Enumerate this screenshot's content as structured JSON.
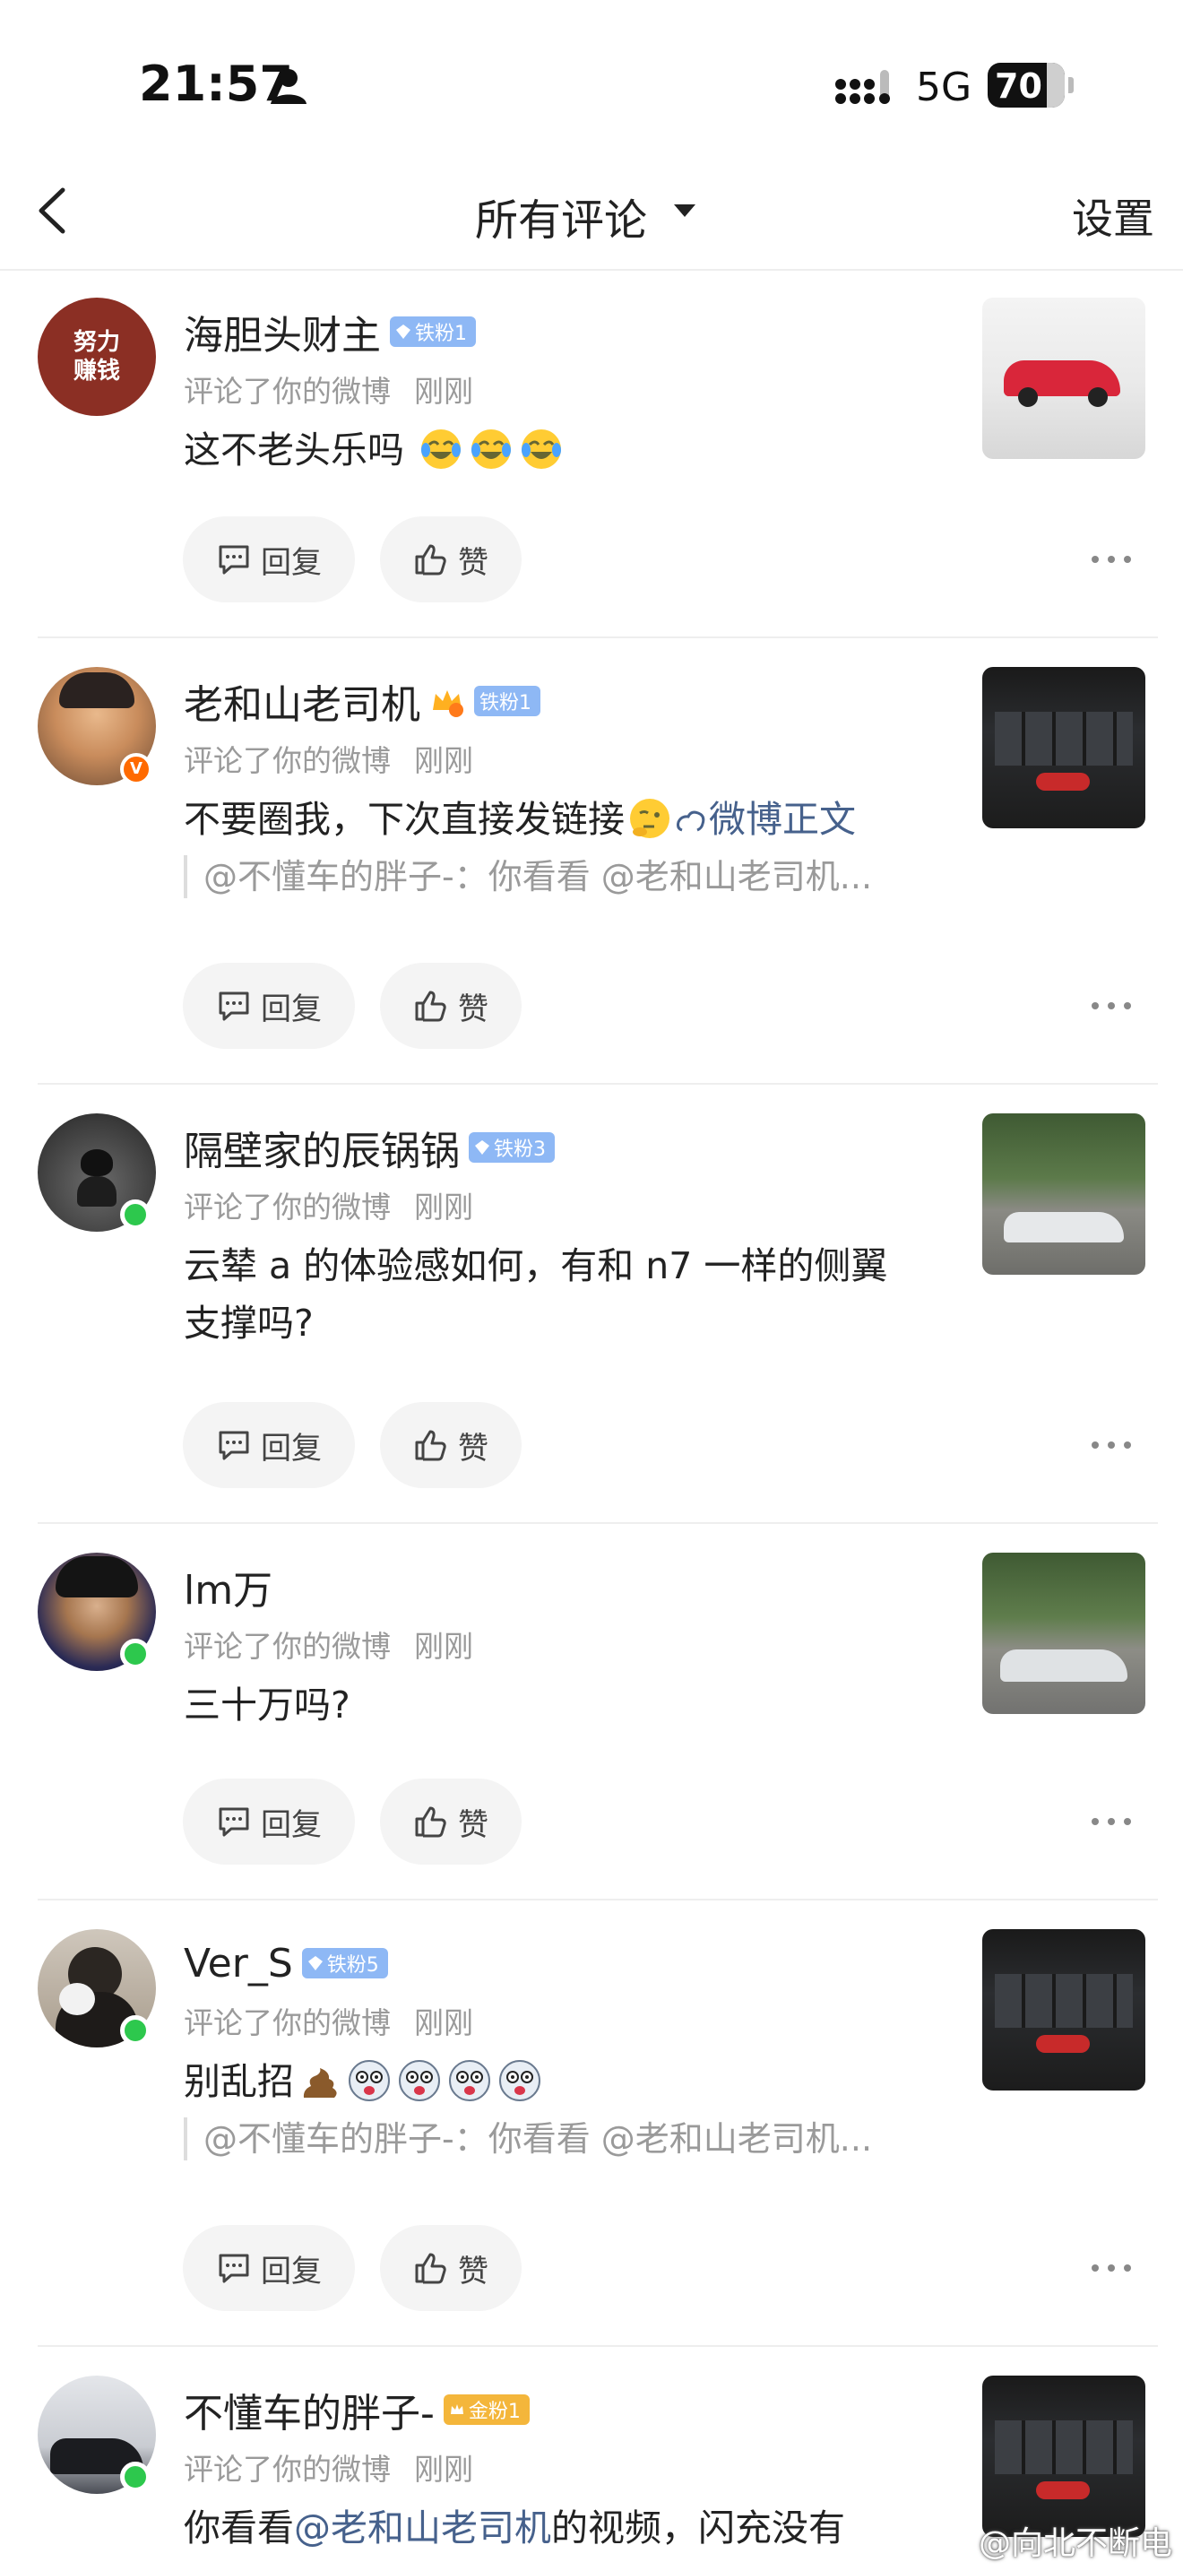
{
  "status_bar": {
    "time": "21:57",
    "network": "5G",
    "battery": "70",
    "icons": [
      "person-icon",
      "signal-icon",
      "battery-icon"
    ]
  },
  "nav": {
    "back_icon": "chevron-left-icon",
    "title": "所有评论",
    "title_icon": "caret-down-icon",
    "settings": "设置"
  },
  "actions": {
    "reply": "回复",
    "like": "赞"
  },
  "comments": [
    {
      "name": "海胆头财主",
      "badge": "铁粉1",
      "meta": "评论了你的微博",
      "time": "刚刚",
      "avatar_text": "努力\n赚钱",
      "text": "这不老头乐吗",
      "emojis": [
        "crying-laughing-emoji",
        "crying-laughing-emoji",
        "crying-laughing-emoji"
      ]
    },
    {
      "name": "老和山老司机",
      "badge": "铁粉1",
      "meta": "评论了你的微博",
      "time": "刚刚",
      "text_before": "不要圈我，下次直接发链接",
      "emoji": "thinking-emoji",
      "link_text": "微博正文",
      "quote": "@不懂车的胖子-：你看看 @老和山老司机..."
    },
    {
      "name": "隔壁家的辰锅锅",
      "badge": "铁粉3",
      "meta": "评论了你的微博",
      "time": "刚刚",
      "text": "云辇 a 的体验感如何，有和 n7 一样的侧翼支撑吗?"
    },
    {
      "name": "lm万",
      "meta": "评论了你的微博",
      "time": "刚刚",
      "text": "三十万吗?"
    },
    {
      "name": "Ver_S",
      "badge": "铁粉5",
      "meta": "评论了你的微博",
      "time": "刚刚",
      "text": "别乱招",
      "emojis": [
        "poop-emoji",
        "dizzy-face-emoji",
        "dizzy-face-emoji",
        "dizzy-face-emoji",
        "dizzy-face-emoji"
      ],
      "quote": "@不懂车的胖子-：你看看 @老和山老司机..."
    },
    {
      "name": "不懂车的胖子-",
      "badge": "金粉1",
      "meta": "评论了你的微博",
      "time": "刚刚",
      "text_before": "你看看",
      "mention": "@老和山老司机",
      "text_after": "的视频，闪充没有"
    }
  ],
  "watermark": "@向北不断电",
  "colors": {
    "link": "#46618c",
    "iron_badge": "#8eb8f5",
    "gold_badge": "#f4b63b",
    "online": "#2dc84d",
    "meta": "#9a9a9a"
  }
}
